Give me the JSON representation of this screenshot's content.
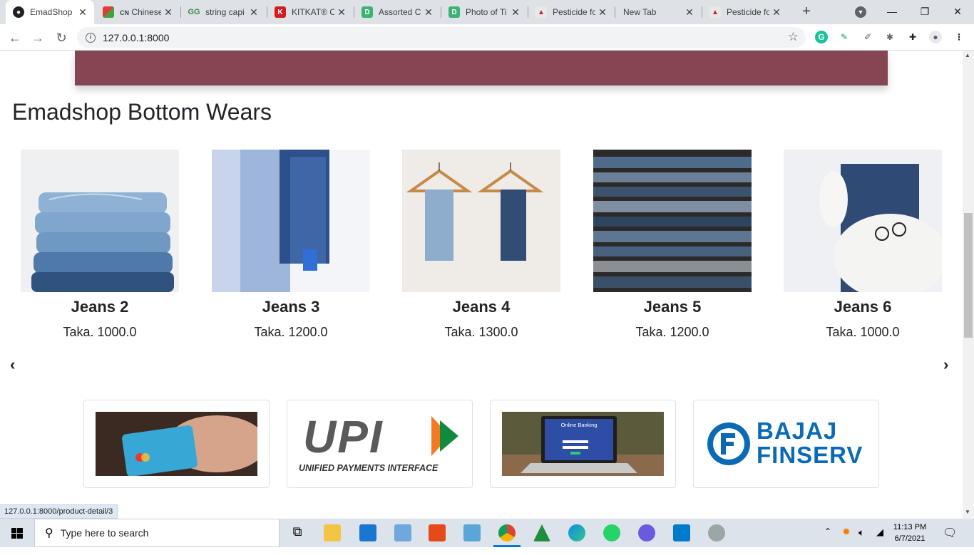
{
  "browser": {
    "tabs": [
      {
        "title": "EmadShop",
        "favicon": "globe-icon",
        "active": true
      },
      {
        "title": "Chinese",
        "prefix": "CN",
        "favicon": "chinese-app-icon"
      },
      {
        "title": "string capi",
        "favicon": "geeks-icon"
      },
      {
        "title": "KITKAT® C",
        "favicon": "kitkat-icon"
      },
      {
        "title": "Assorted C",
        "favicon": "d-icon"
      },
      {
        "title": "Photo of Ti",
        "favicon": "d-icon"
      },
      {
        "title": "Pesticide fo",
        "favicon": "pesticide-icon"
      },
      {
        "title": "New Tab",
        "favicon": ""
      },
      {
        "title": "Pesticide fo",
        "favicon": "pesticide-icon"
      }
    ],
    "url": "127.0.0.1:8000",
    "status_url": "127.0.0.1:8000/product-detail/3"
  },
  "page": {
    "section_title": "Emadshop Bottom Wears",
    "products": [
      {
        "name": "Jeans 2",
        "price": "Taka. 1000.0"
      },
      {
        "name": "Jeans 3",
        "price": "Taka. 1200.0"
      },
      {
        "name": "Jeans 4",
        "price": "Taka. 1300.0"
      },
      {
        "name": "Jeans 5",
        "price": "Taka. 1200.0"
      },
      {
        "name": "Jeans 6",
        "price": "Taka. 1000.0"
      }
    ],
    "carousel_prev": "‹",
    "carousel_next": "›",
    "payments": {
      "upi_main": "UPI",
      "upi_sub": "UNIFIED PAYMENTS INTERFACE",
      "online_banking": "Online Banking",
      "bajaj_line1": "BAJAJ",
      "bajaj_line2": "FINSERV"
    },
    "colors": {
      "banner": "#854552",
      "bajaj_blue": "#0a6ab6"
    }
  },
  "taskbar": {
    "search_placeholder": "Type here to search",
    "time": "11:13 PM",
    "date": "6/7/2021"
  }
}
